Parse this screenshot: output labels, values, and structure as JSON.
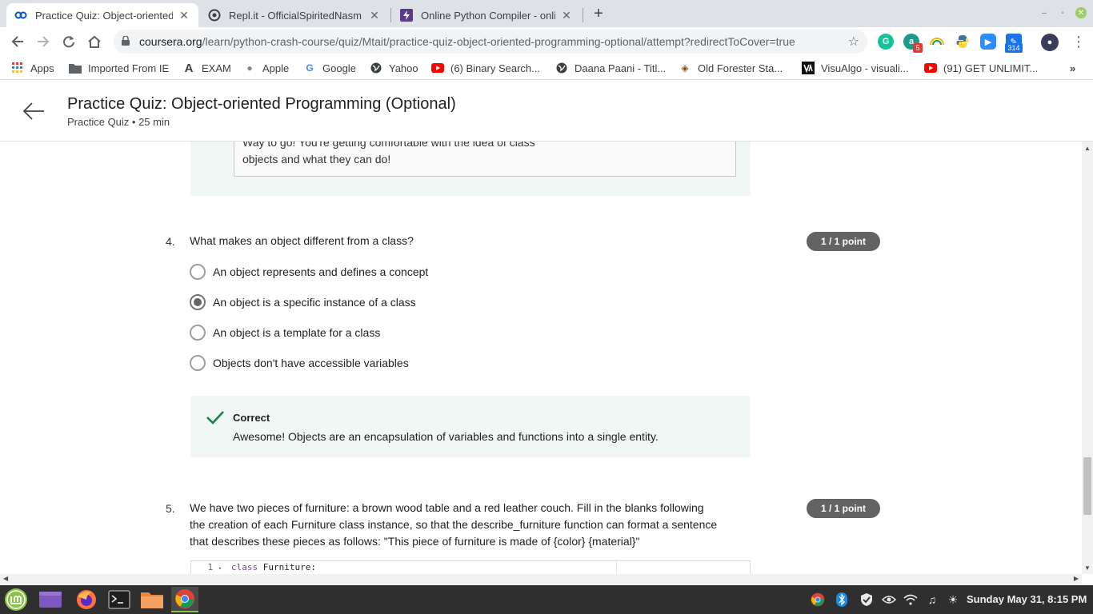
{
  "browser": {
    "tabs": [
      {
        "title": "Practice Quiz: Object-oriented",
        "icon": "coursera-icon"
      },
      {
        "title": "Repl.it - OfficialSpiritedNasm",
        "icon": "replit-icon"
      },
      {
        "title": "Online Python Compiler - onli",
        "icon": "compiler-icon"
      }
    ],
    "new_tab_label": "+",
    "url_host": "coursera.org",
    "url_path": "/learn/python-crash-course/quiz/Mtait/practice-quiz-object-oriented-programming-optional/attempt?redirectToCover=true",
    "extension_badges": {
      "a_count": "5",
      "calendar_count": "314"
    }
  },
  "bookmarks": [
    {
      "label": "Apps"
    },
    {
      "label": "Imported From IE"
    },
    {
      "label": "EXAM"
    },
    {
      "label": "Apple"
    },
    {
      "label": "Google"
    },
    {
      "label": "Yahoo"
    },
    {
      "label": "(6) Binary Search..."
    },
    {
      "label": "Daana Paani - Titl..."
    },
    {
      "label": "Old Forester Sta..."
    },
    {
      "label": "VisuAlgo - visuali..."
    },
    {
      "label": "(91) GET UNLIMIT..."
    }
  ],
  "page": {
    "title": "Practice Quiz: Object-oriented Programming (Optional)",
    "subtitle": "Practice Quiz • 25 min"
  },
  "prev_feedback": {
    "text_line1": "Way to go! You're getting comfortable with the idea of class",
    "text_line2": "objects and what they can do!"
  },
  "questions": [
    {
      "number": "4.",
      "text": "What makes an object different from a class?",
      "points": "1 / 1 point",
      "options": [
        {
          "label": "An object represents and defines a concept",
          "selected": false
        },
        {
          "label": "An object is a specific instance of a class",
          "selected": true
        },
        {
          "label": "An object is a template for a class",
          "selected": false
        },
        {
          "label": "Objects don't have accessible variables",
          "selected": false
        }
      ],
      "feedback": {
        "status": "Correct",
        "message": "Awesome! Objects are an encapsulation of variables and functions into a single entity."
      }
    },
    {
      "number": "5.",
      "text_line1": "We have two pieces of furniture: a brown wood table and a red leather couch. Fill in the blanks following",
      "text_line2": "the creation of each Furniture class instance, so that the describe_furniture function can format a sentence",
      "text_line3": "that describes these pieces as follows: \"This piece of furniture is made of {color} {material}\"",
      "points": "1 / 1 point",
      "code": {
        "line_number": "1",
        "keyword": "class",
        "rest": " Furniture:"
      }
    }
  ],
  "taskbar": {
    "clock": "Sunday May 31,  8:15 PM"
  },
  "colors": {
    "points_badge": "#636363",
    "feedback_bg": "#f0f7f4",
    "check": "#1e7e44",
    "accent_taskbar": "#8ac34a"
  }
}
